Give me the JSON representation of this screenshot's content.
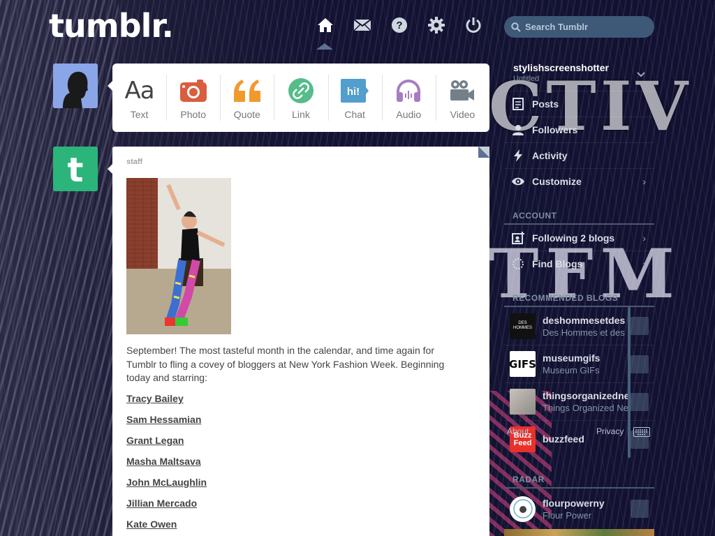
{
  "header": {
    "logo": "tumblr.",
    "nav": [
      {
        "name": "home-icon"
      },
      {
        "name": "mail-icon"
      },
      {
        "name": "help-icon"
      },
      {
        "name": "settings-icon"
      },
      {
        "name": "power-icon"
      }
    ],
    "search_placeholder": "Search Tumblr"
  },
  "post_types": [
    {
      "label": "Text",
      "icon": "text-icon",
      "color": "#444444",
      "glyph": "Aa"
    },
    {
      "label": "Photo",
      "icon": "camera-icon",
      "color": "#d95e40"
    },
    {
      "label": "Quote",
      "icon": "quote-icon",
      "color": "#f2992e",
      "glyph": "66"
    },
    {
      "label": "Link",
      "icon": "link-icon",
      "color": "#56bc8a"
    },
    {
      "label": "Chat",
      "icon": "chat-icon",
      "color": "#529ecc",
      "glyph": "hi!"
    },
    {
      "label": "Audio",
      "icon": "headphones-icon",
      "color": "#a77dc2"
    },
    {
      "label": "Video",
      "icon": "video-camera-icon",
      "color": "#748089"
    }
  ],
  "post": {
    "author": "staff",
    "body": "September! The most tasteful month in the calendar, and time again for Tumblr to fling a covey of bloggers at New York Fashion Week. Beginning today and starring:",
    "links": [
      "Tracy Bailey",
      "Sam Hessamian",
      "Grant Legan",
      "Masha Maltsava",
      "John McLaughlin",
      "Jillian Mercado",
      "Kate Owen"
    ]
  },
  "sidebar": {
    "blog_name": "stylishscreenshotter",
    "blog_subtitle": "Untitled",
    "items": [
      {
        "label": "Posts",
        "icon": "posts-icon"
      },
      {
        "label": "Followers",
        "icon": "followers-icon"
      },
      {
        "label": "Activity",
        "icon": "activity-icon"
      },
      {
        "label": "Customize",
        "icon": "eye-icon"
      }
    ],
    "account_label": "ACCOUNT",
    "account_items": [
      {
        "label": "Following 2 blogs",
        "icon": "following-icon"
      },
      {
        "label": "Find Blogs",
        "icon": "find-blogs-icon"
      }
    ],
    "recommended_label": "RECOMMENDED BLOGS",
    "recommended": [
      {
        "name": "deshommesetdes",
        "title": "Des Hommes et des",
        "thumb_text": "DES HOMMES"
      },
      {
        "name": "museumgifs",
        "title": "Museum GIFs",
        "thumb_text": "GIFS"
      },
      {
        "name": "thingsorganizedne",
        "title": "Things Organized Ne",
        "thumb_text": ""
      },
      {
        "name": "buzzfeed",
        "title": "",
        "thumb_text": "Buzz Feed"
      }
    ],
    "footer": {
      "about": "About",
      "privacy": "Privacy"
    },
    "radar_label": "RADAR",
    "radar": {
      "name": "flourpowerny",
      "title": "Flour Power"
    }
  },
  "background": {
    "deco_text_1": "CTIV",
    "deco_text_2": "TFM"
  }
}
